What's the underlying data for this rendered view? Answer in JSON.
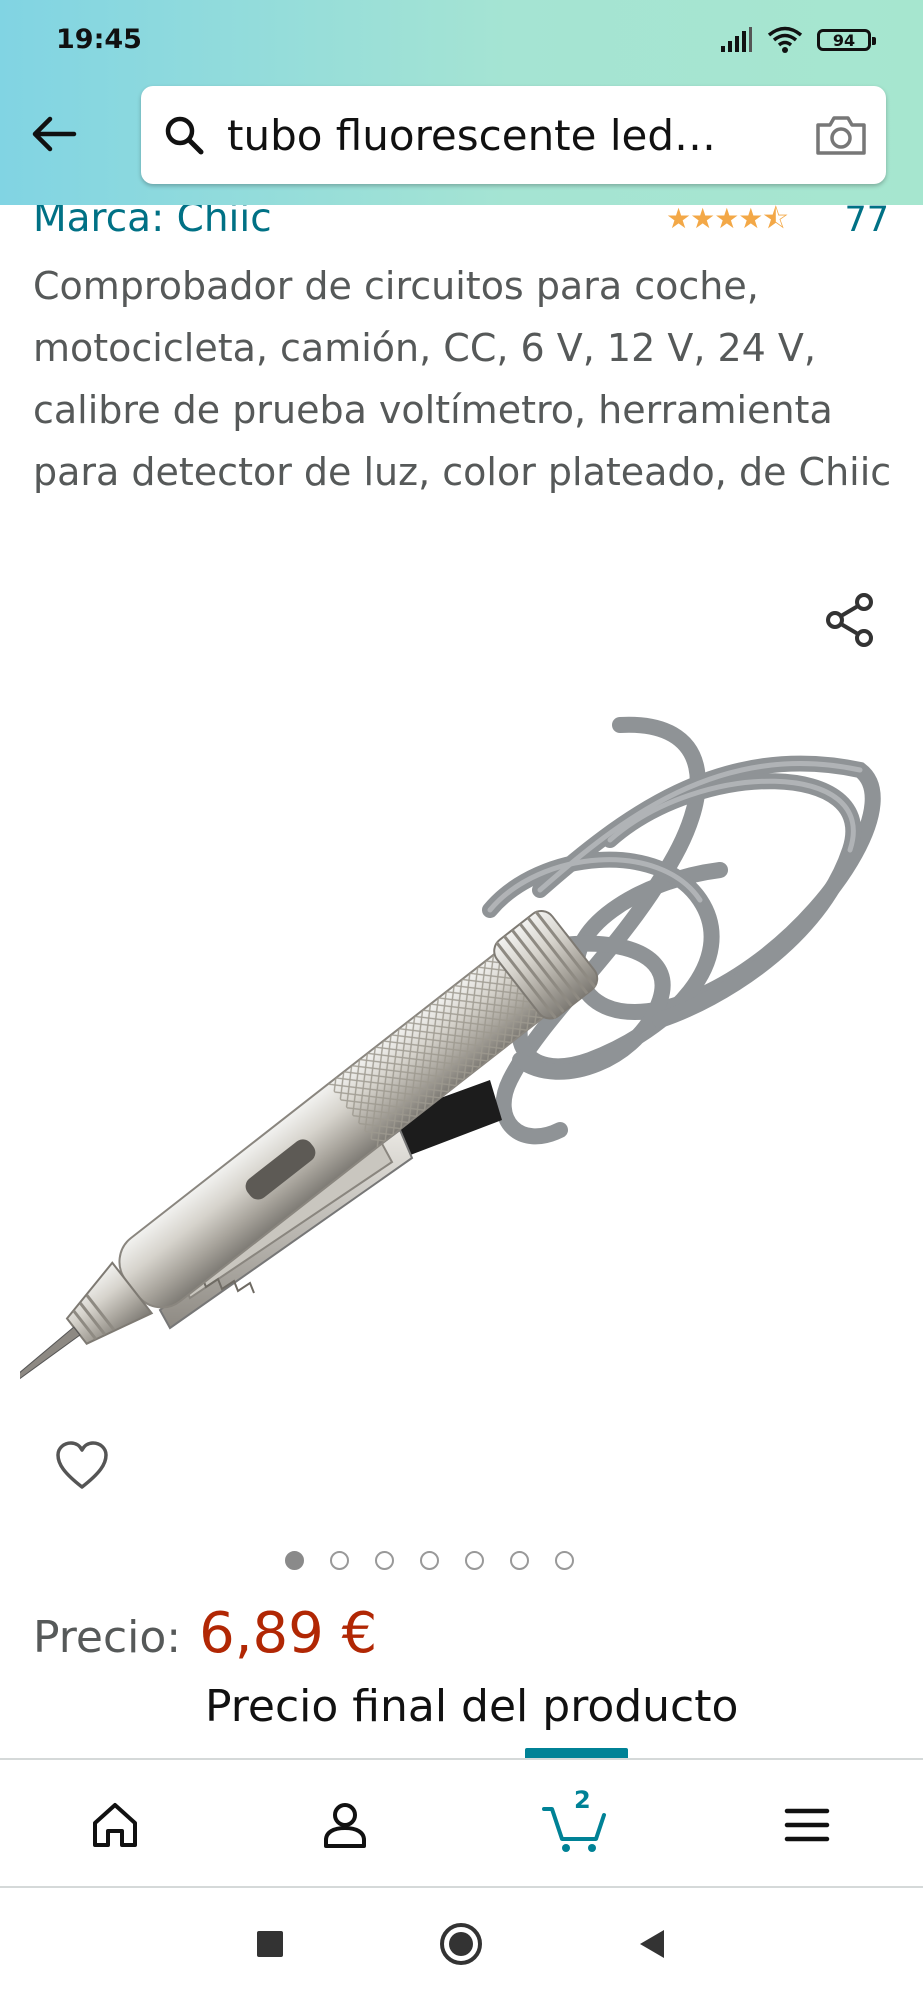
{
  "status_bar": {
    "time": "19:45",
    "battery": "94",
    "icons": [
      "signal-icon",
      "wifi-icon",
      "battery-icon"
    ]
  },
  "search": {
    "query": "tubo fluorescente led…",
    "back_icon": "arrow-left-icon",
    "search_icon": "search-icon",
    "camera_icon": "camera-icon"
  },
  "product": {
    "brand": "Marca: Chiic",
    "rating_stars": "★★★★⯪",
    "rating_value": 4.5,
    "rating_count": "77",
    "title": "Comprobador de circuitos para coche, motocicleta, camión, CC, 6 V, 12 V, 24 V, calibre de prueba voltímetro, herramienta para detector de luz, color plateado, de Chiic",
    "image_count": 7,
    "active_image_index": 0,
    "price_label": "Precio:",
    "price": "6,89 €",
    "price_note": "Precio final del producto"
  },
  "bottom_nav": {
    "items": [
      "home-icon",
      "account-icon",
      "cart-icon",
      "menu-icon"
    ],
    "active": "cart-icon",
    "cart_count": "2"
  },
  "system_nav": {
    "items": [
      "recents-button",
      "home-button",
      "back-button"
    ]
  },
  "colors": {
    "header_gradient_start": "#81d4e3",
    "header_gradient_end": "#a6e6cf",
    "link": "#007185",
    "price": "#b12704",
    "accent": "#008296",
    "star": "#f3a847"
  }
}
